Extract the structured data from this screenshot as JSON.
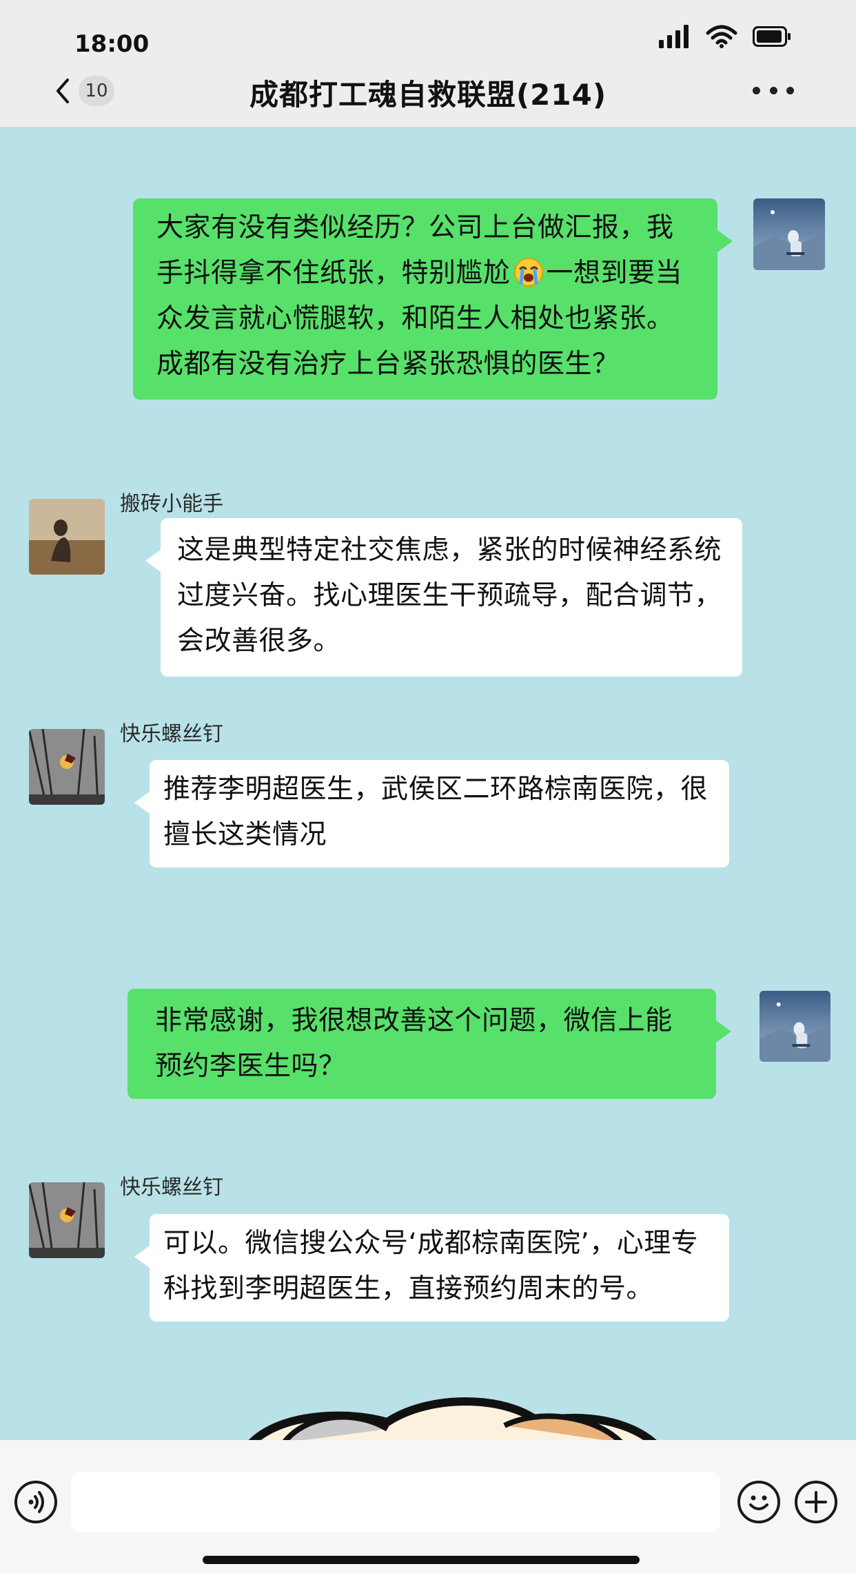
{
  "status_bar": {
    "time": "18:00",
    "icons": [
      "cellular-signal-icon",
      "wifi-icon",
      "battery-icon"
    ]
  },
  "header": {
    "back_icon": "chevron-left-icon",
    "unread_count": "10",
    "title": "成都打工魂自救联盟(214)",
    "more_icon": "more-dots-icon"
  },
  "messages": [
    {
      "side": "self",
      "text_before_emoji": "大家有没有类似经历？公司上台做汇报，我手抖得拿不住纸张，特别尴尬",
      "emoji": "loudly-crying-face-emoji",
      "text_after_emoji": "一想到要当众发言就心慌腿软，和陌生人相处也紧张。成都有没有治疗上台紧张恐惧的医生？"
    },
    {
      "side": "other",
      "sender": "搬砖小能手",
      "text": "这是典型特定社交焦虑，紧张的时候神经系统过度兴奋。找心理医生干预疏导，配合调节，会改善很多。"
    },
    {
      "side": "other",
      "sender": "快乐螺丝钉",
      "text": "推荐李明超医生，武侯区二环路棕南医院，很擅长这类情况"
    },
    {
      "side": "self",
      "text": "非常感谢，我很想改善这个问题，微信上能预约李医生吗？"
    },
    {
      "side": "other",
      "sender": "快乐螺丝钉",
      "text": "可以。微信搜公众号‘成都棕南医院’，心理专科找到李明超医生，直接预约周末的号。"
    }
  ],
  "input_bar": {
    "voice_icon": "voice-icon",
    "input_value": "",
    "emoji_icon": "smile-icon",
    "plus_icon": "plus-icon"
  },
  "colors": {
    "header_bg": "#ededed",
    "chat_bg": "#b8e2e8",
    "self_bubble": "#57e06a",
    "other_bubble": "#ffffff"
  }
}
